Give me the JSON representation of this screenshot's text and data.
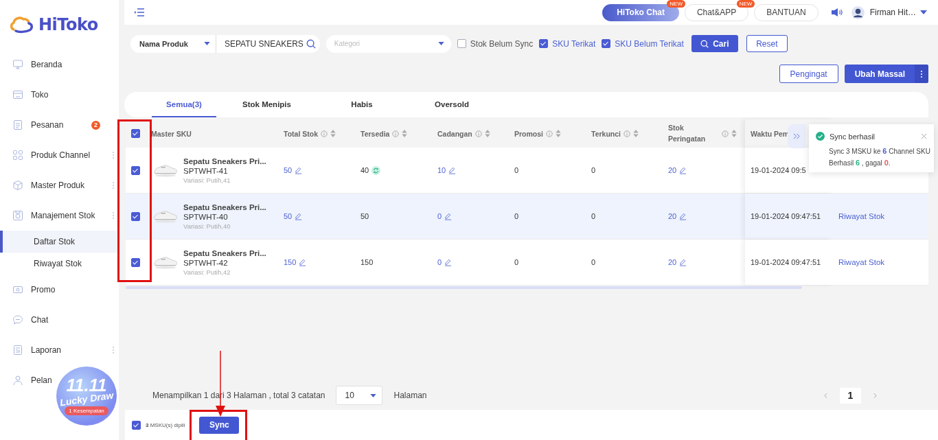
{
  "brand": {
    "name": "HiToko"
  },
  "sidebar": {
    "items": [
      {
        "label": "Beranda",
        "selected": false,
        "has_menu": false
      },
      {
        "label": "Toko",
        "selected": false,
        "has_menu": false
      },
      {
        "label": "Pesanan",
        "selected": false,
        "has_menu": false,
        "badge": "2"
      },
      {
        "label": "Produk Channel",
        "selected": false,
        "has_menu": true
      },
      {
        "label": "Master Produk",
        "selected": false,
        "has_menu": true
      },
      {
        "label": "Manajement Stok",
        "selected": false,
        "has_menu": true,
        "expanded": true,
        "children": [
          {
            "label": "Daftar Stok",
            "selected": true
          },
          {
            "label": "Riwayat Stok",
            "selected": false
          }
        ]
      },
      {
        "label": "Promo",
        "selected": false,
        "has_menu": false
      },
      {
        "label": "Chat",
        "selected": false,
        "has_menu": false
      },
      {
        "label": "Laporan",
        "selected": false,
        "has_menu": true
      },
      {
        "label": "Pelan",
        "selected": false,
        "has_menu": false
      }
    ]
  },
  "promo": {
    "title": "11.11",
    "subtitle": "Lucky Draw",
    "chances": "1 Kesempatan"
  },
  "topbar": {
    "buttons": [
      {
        "label": "HiToko Chat",
        "kind": "gradient",
        "badge": "NEW"
      },
      {
        "label": "Chat&APP",
        "kind": "outline",
        "badge": "NEW"
      },
      {
        "label": "BANTUAN",
        "kind": "outline"
      }
    ],
    "user": "Firman Hit…"
  },
  "filters": {
    "field_select": "Nama Produk",
    "search_value": "SEPATU SNEAKERS",
    "category_placeholder": "Kategori",
    "checkboxes": [
      {
        "label": "Stok Belum Sync",
        "checked": false
      },
      {
        "label": "SKU Terikat",
        "checked": true
      },
      {
        "label": "SKU Belum Terikat",
        "checked": true
      }
    ],
    "search_button": "Cari",
    "reset_button": "Reset"
  },
  "actions": {
    "reminder_button": "Pengingat",
    "bulk_button": "Ubah Massal"
  },
  "tabs": [
    {
      "label": "Semua(3)",
      "selected": true
    },
    {
      "label": "Stok Menipis",
      "selected": false
    },
    {
      "label": "Habis",
      "selected": false
    },
    {
      "label": "Oversold",
      "selected": false
    }
  ],
  "table": {
    "all_checked": true,
    "columns": [
      {
        "label": "Master SKU",
        "info": false
      },
      {
        "label": "Total Stok",
        "info": true
      },
      {
        "label": "Tersedia",
        "info": true
      },
      {
        "label": "Cadangan",
        "info": true
      },
      {
        "label": "Promosi",
        "info": true
      },
      {
        "label": "Terkunci",
        "info": true
      },
      {
        "label": "Stok Peringatan",
        "info": true
      },
      {
        "label": "Waktu Pem",
        "info": false
      }
    ],
    "rows": [
      {
        "checked": true,
        "highlighted": false,
        "cells": [
          {
            "kind": "product",
            "name": "Sepatu Sneakers Pri...",
            "sku": "SPTWHT-41",
            "variation": "Variasi: Putih,41"
          },
          {
            "value": "50",
            "kind": "edit"
          },
          {
            "value": "40",
            "kind": "sync"
          },
          {
            "value": "10",
            "kind": "edit"
          },
          {
            "value": "0",
            "kind": "plain"
          },
          {
            "value": "0",
            "kind": "plain"
          },
          {
            "value": "20",
            "kind": "edit"
          },
          {
            "value": "19-01-2024 09:5",
            "kind": "plain"
          }
        ]
      },
      {
        "checked": true,
        "highlighted": true,
        "cells": [
          {
            "kind": "product",
            "name": "Sepatu Sneakers Pri...",
            "sku": "SPTWHT-40",
            "variation": "Variasi: Putih,40"
          },
          {
            "value": "50",
            "kind": "edit"
          },
          {
            "value": "50",
            "kind": "plain"
          },
          {
            "value": "0",
            "kind": "edit"
          },
          {
            "value": "0",
            "kind": "plain"
          },
          {
            "value": "0",
            "kind": "plain"
          },
          {
            "value": "20",
            "kind": "edit"
          },
          {
            "value": "19-01-2024 09:47:51",
            "kind": "plain"
          }
        ],
        "action": "Riwayat Stok"
      },
      {
        "checked": true,
        "highlighted": false,
        "cells": [
          {
            "kind": "product",
            "name": "Sepatu Sneakers Pri...",
            "sku": "SPTWHT-42",
            "variation": "Variasi: Putih,42"
          },
          {
            "value": "150",
            "kind": "edit"
          },
          {
            "value": "150",
            "kind": "plain"
          },
          {
            "value": "0",
            "kind": "edit"
          },
          {
            "value": "0",
            "kind": "plain"
          },
          {
            "value": "0",
            "kind": "plain"
          },
          {
            "value": "20",
            "kind": "edit"
          },
          {
            "value": "19-01-2024 09:47:51",
            "kind": "plain"
          }
        ],
        "action": "Riwayat Stok"
      }
    ]
  },
  "toast": {
    "title": "Sync berhasil",
    "lines": [
      [
        {
          "text": "Sync 3 MSKU ke "
        },
        {
          "text": "6",
          "color": "#4a5fd0"
        },
        {
          "text": " Channel SKU"
        }
      ],
      [
        {
          "text": "Berhasil "
        },
        {
          "text": "6",
          "color": "#2bb58a"
        },
        {
          "text": " , gagal "
        },
        {
          "text": "0",
          "color": "#e85a5a"
        },
        {
          "text": "."
        }
      ]
    ]
  },
  "pagination": {
    "summary": "Menampilkan 1 dari 3 Halaman , total 3 catatan",
    "page_size": "10",
    "page_label": "Halaman",
    "pages": [
      {
        "label": "1",
        "selected": true
      }
    ]
  },
  "bottom_bar": {
    "checked": true,
    "selection": "**3** MSKU(s) dipili",
    "sync_button": "Sync"
  }
}
